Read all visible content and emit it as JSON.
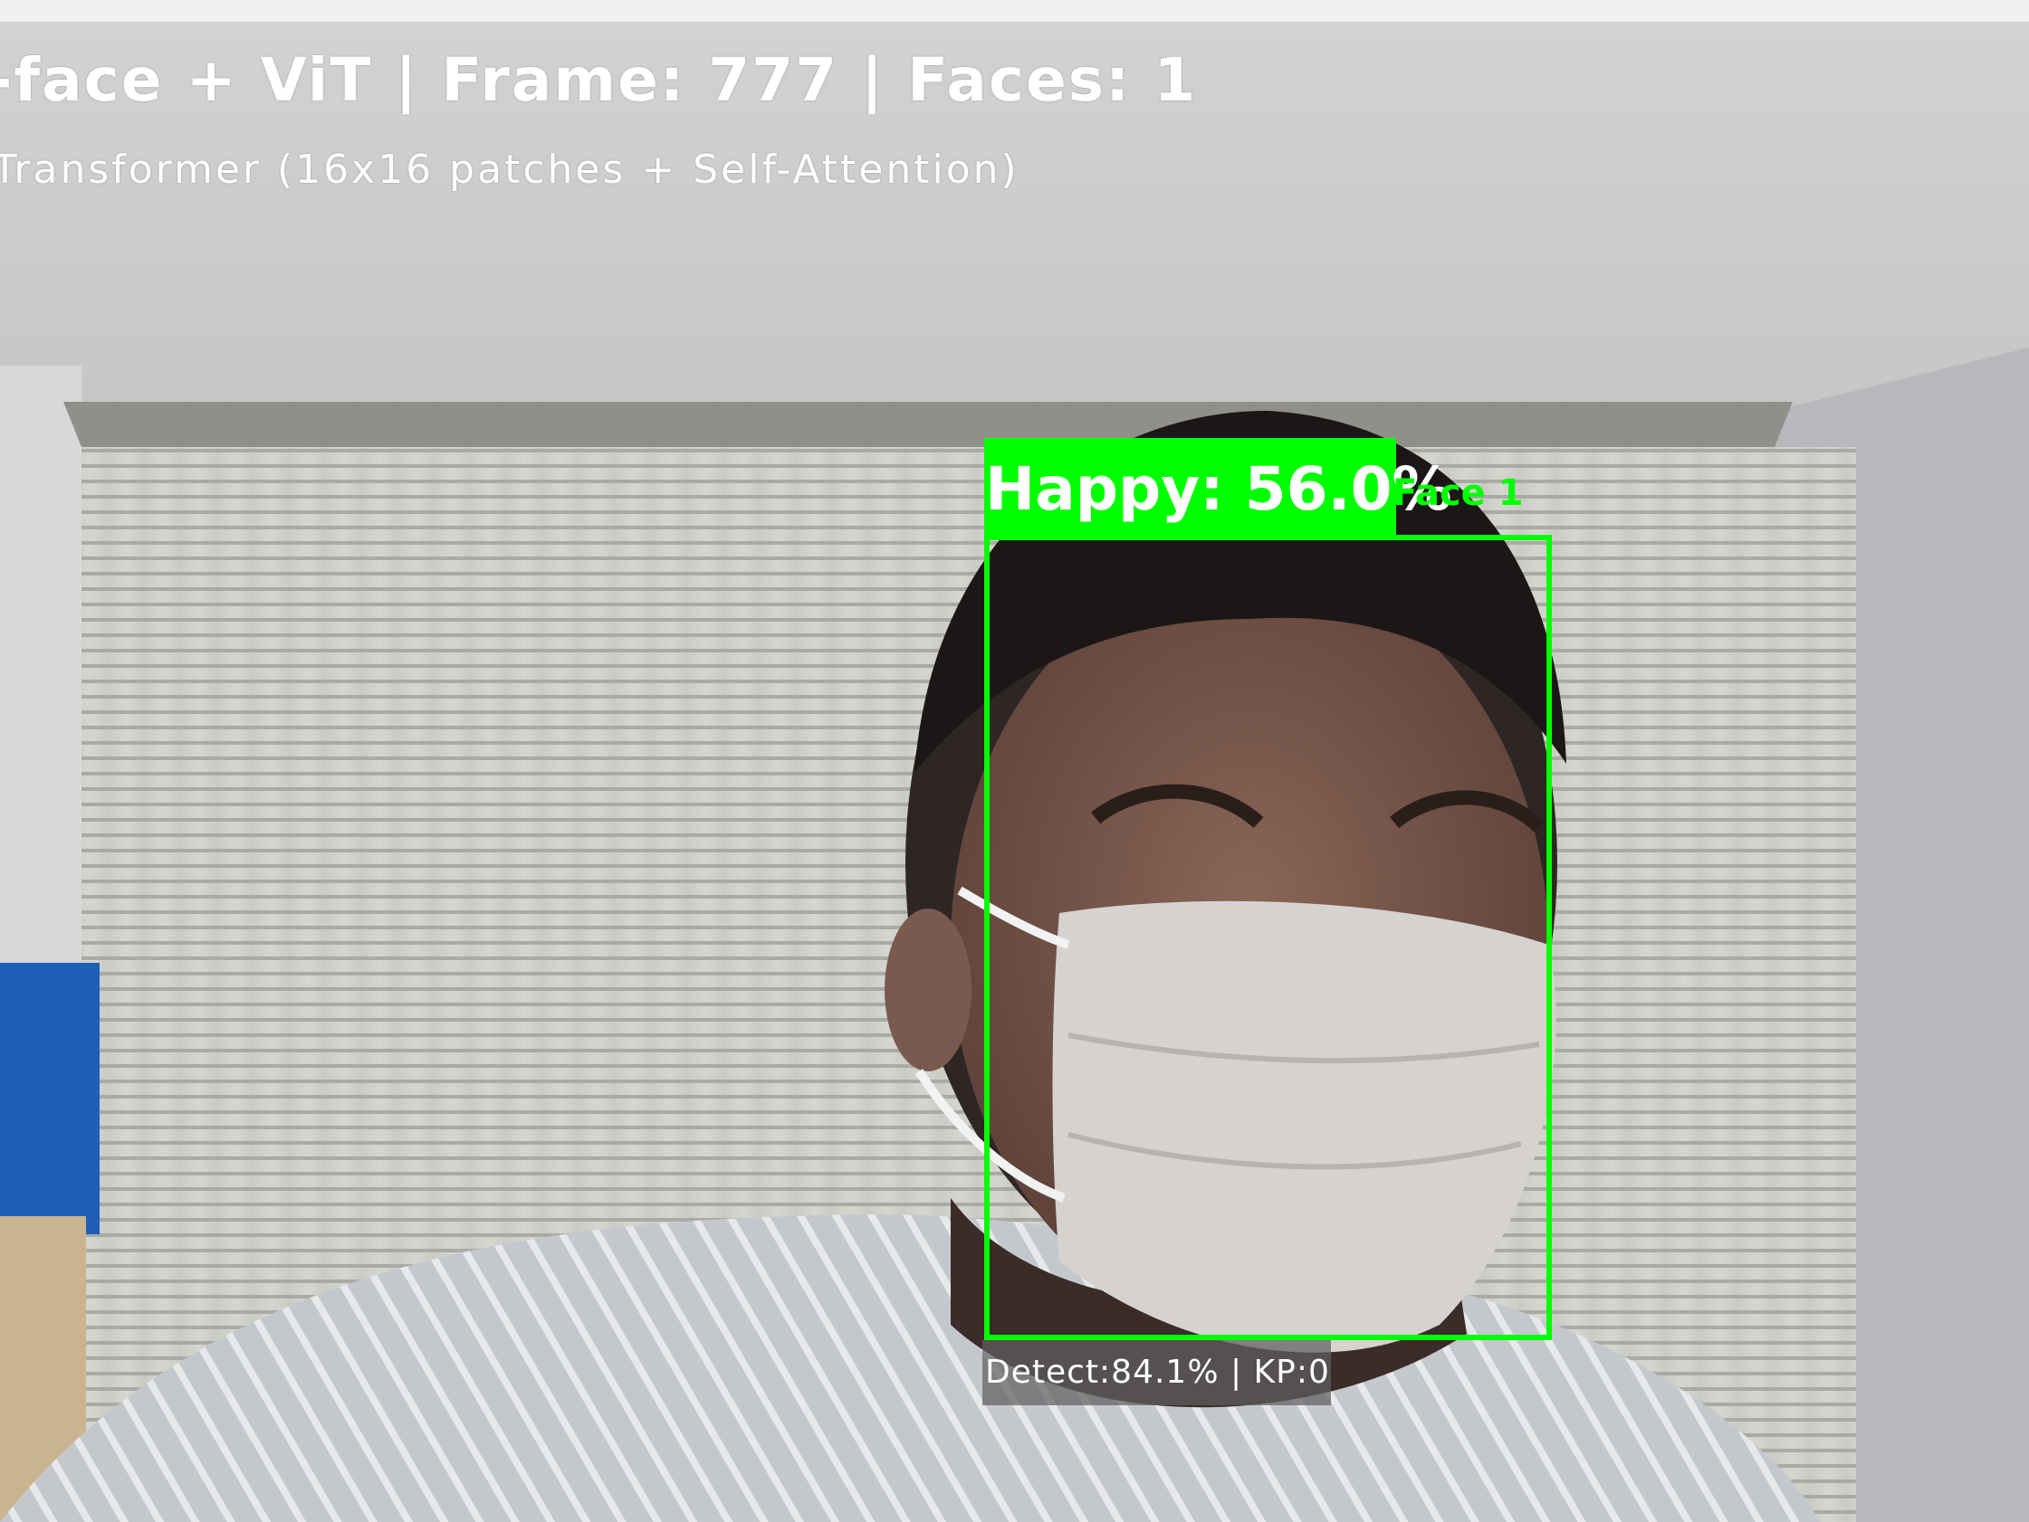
{
  "overlay": {
    "header": "-face + ViT | Frame: 777 | Faces: 1",
    "subheader": "Transformer (16x16 patches + Self-Attention)"
  },
  "detections": [
    {
      "label": "Face 1",
      "emotion": "Happy: 56.0%",
      "info": "Detect:84.1% | KP:0"
    }
  ],
  "colors": {
    "box": "#00ff00",
    "overlay_text": "#ffffff",
    "info_bg": "#5f5f5f"
  }
}
